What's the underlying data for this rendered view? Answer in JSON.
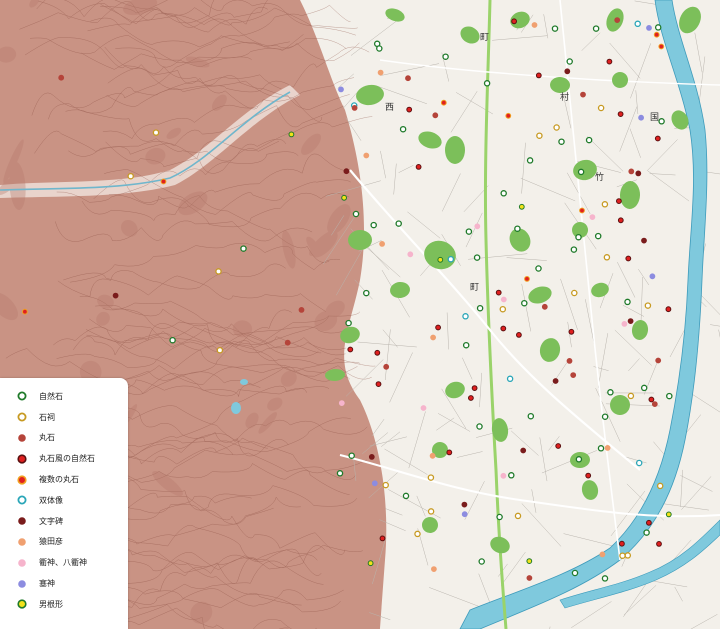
{
  "legend": {
    "items": [
      {
        "label": "自然石",
        "icon": "ring-marker-green",
        "fill": "#ffffff",
        "stroke": "#1f7a2a"
      },
      {
        "label": "石祠",
        "icon": "ring-marker-gold",
        "fill": "#ffffff",
        "stroke": "#c79a22"
      },
      {
        "label": "丸石",
        "icon": "dot-marker-brick",
        "fill": "#b5443a",
        "stroke": "#b5443a"
      },
      {
        "label": "丸石風の自然石",
        "icon": "dot-marker-red-dark-ring",
        "fill": "#e02020",
        "stroke": "#5a1010"
      },
      {
        "label": "複数の丸石",
        "icon": "dot-marker-red-orange-ring",
        "fill": "#e02020",
        "stroke": "#f0a020"
      },
      {
        "label": "双体像",
        "icon": "ring-marker-teal",
        "fill": "#ffffff",
        "stroke": "#2aa6b8"
      },
      {
        "label": "文字碑",
        "icon": "dot-marker-maroon",
        "fill": "#7a1c1c",
        "stroke": "#7a1c1c"
      },
      {
        "label": "猿田彦",
        "icon": "dot-marker-salmon",
        "fill": "#f0a070",
        "stroke": "#f0a070"
      },
      {
        "label": "衢神、八衢神",
        "icon": "dot-marker-pink",
        "fill": "#f6b4cc",
        "stroke": "#f6b4cc"
      },
      {
        "label": "塞神",
        "icon": "dot-marker-lavender",
        "fill": "#8c8ce0",
        "stroke": "#8c8ce0"
      },
      {
        "label": "男根形",
        "icon": "dot-marker-yellow-green-ring",
        "fill": "#f2e21a",
        "stroke": "#1f7a2a"
      }
    ]
  },
  "map": {
    "colors": {
      "mountain": "#c99384",
      "mountain_shade": "#b47a6b",
      "plain": "#f3f0ea",
      "river": "#7fc9dd",
      "river_edge": "#3e9bbb",
      "park": "#7cbf5a",
      "road_main": "#9ad36a",
      "road": "#ffffff",
      "contour": "#8a4e42"
    },
    "place_labels": [
      "西",
      "町",
      "村",
      "竹",
      "国",
      "町"
    ]
  }
}
